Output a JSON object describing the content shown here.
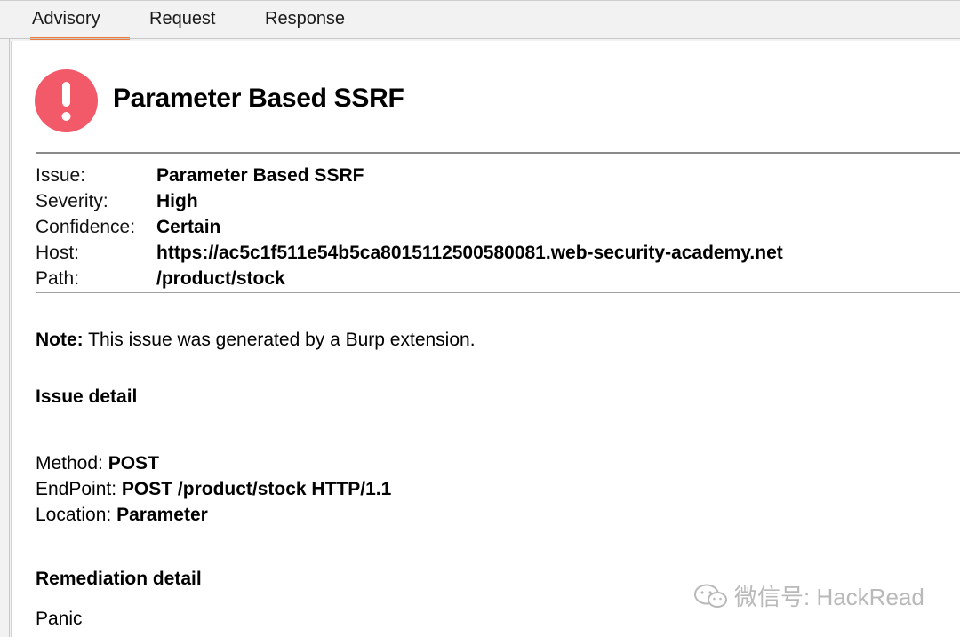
{
  "tabs": [
    {
      "label": "Advisory",
      "active": true
    },
    {
      "label": "Request",
      "active": false
    },
    {
      "label": "Response",
      "active": false
    }
  ],
  "accent_color": "#ef7b3b",
  "severity_color": "#f25a6a",
  "issue_title": "Parameter Based SSRF",
  "details": {
    "issue": {
      "label": "Issue:",
      "value": "Parameter Based SSRF"
    },
    "severity": {
      "label": "Severity:",
      "value": "High"
    },
    "confidence": {
      "label": "Confidence:",
      "value": "Certain"
    },
    "host": {
      "label": "Host:",
      "value": "https://ac5c1f511e54b5ca8015112500580081.web-security-academy.net"
    },
    "path": {
      "label": "Path:",
      "value": "/product/stock"
    }
  },
  "note": {
    "label": "Note:",
    "text": " This issue was generated by a Burp extension."
  },
  "issue_detail": {
    "heading": "Issue detail",
    "method": {
      "label": "Method: ",
      "value": "POST"
    },
    "endpoint": {
      "label": "EndPoint: ",
      "value": "POST /product/stock HTTP/1.1"
    },
    "location": {
      "label": "Location: ",
      "value": "Parameter"
    }
  },
  "remediation": {
    "heading": "Remediation detail",
    "text": "Panic"
  },
  "watermark": "微信号: HackRead"
}
